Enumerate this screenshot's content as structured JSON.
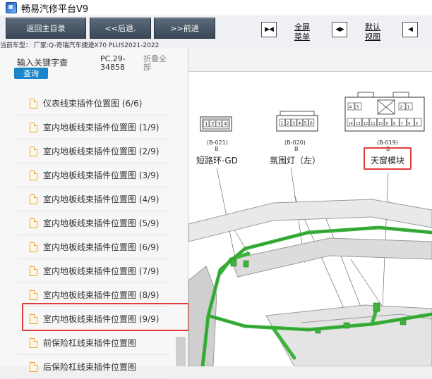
{
  "window": {
    "title": "畅易汽修平台V9"
  },
  "toolbar": {
    "back_main": "返回主目录",
    "back": "<<后退.",
    "forward": ">>前进",
    "fullscreen_label": "全屏\n菜单",
    "default_view_label": "默认\n视图"
  },
  "vehicle": {
    "current": "当前车型：  厂家:Q-奇瑞汽车捷途X70 PLUS2021-2022"
  },
  "search": {
    "label": "输入关键字查",
    "query_button": "查询",
    "pc_code": "PC.29-34858",
    "collapse_all": "折叠全部"
  },
  "tree": {
    "items": [
      {
        "label": "仪表线束插件位置图 (6/6)"
      },
      {
        "label": "室内地板线束插件位置图 (1/9)"
      },
      {
        "label": "室内地板线束插件位置图 (2/9)"
      },
      {
        "label": "室内地板线束插件位置图 (3/9)"
      },
      {
        "label": "室内地板线束插件位置图 (4/9)"
      },
      {
        "label": "室内地板线束插件位置图 (5/9)"
      },
      {
        "label": "室内地板线束插件位置图 (6/9)"
      },
      {
        "label": "室内地板线束插件位置图 (7/9)"
      },
      {
        "label": "室内地板线束插件位置图 (8/9)"
      },
      {
        "label": "室内地板线束插件位置图 (9/9)",
        "selected": true
      },
      {
        "label": "前保险杠线束插件位置图"
      },
      {
        "label": "后保险杠线束插件位置图"
      }
    ]
  },
  "diagram": {
    "connectors": [
      {
        "code": "B-021",
        "letter": "B",
        "name": "短路环-GD",
        "pins": [
          "1",
          "2",
          "3",
          "4"
        ]
      },
      {
        "code": "B-020",
        "letter": "B",
        "name": "氛围灯（左）",
        "pins": [
          "1",
          "2",
          "3",
          "4",
          "5",
          "6"
        ]
      },
      {
        "code": "B-019",
        "letter": "B",
        "name": "天窗模块",
        "top_pins": [
          "4",
          "3",
          "2",
          "1"
        ],
        "bottom_pins": [
          "14",
          "13",
          "12",
          "11",
          "10",
          "9",
          "8",
          "7",
          "6",
          "5"
        ]
      }
    ]
  },
  "colors": {
    "selection": "#e23b3b",
    "harness": "#3cb43c",
    "query": "#1a86c9"
  },
  "icons": {
    "app": "app-logo-icon",
    "fullscreen": "fullscreen-toggle-icon",
    "default_view": "default-view-icon",
    "next_panel": "panel-toggle-icon",
    "doc": "document-icon"
  }
}
